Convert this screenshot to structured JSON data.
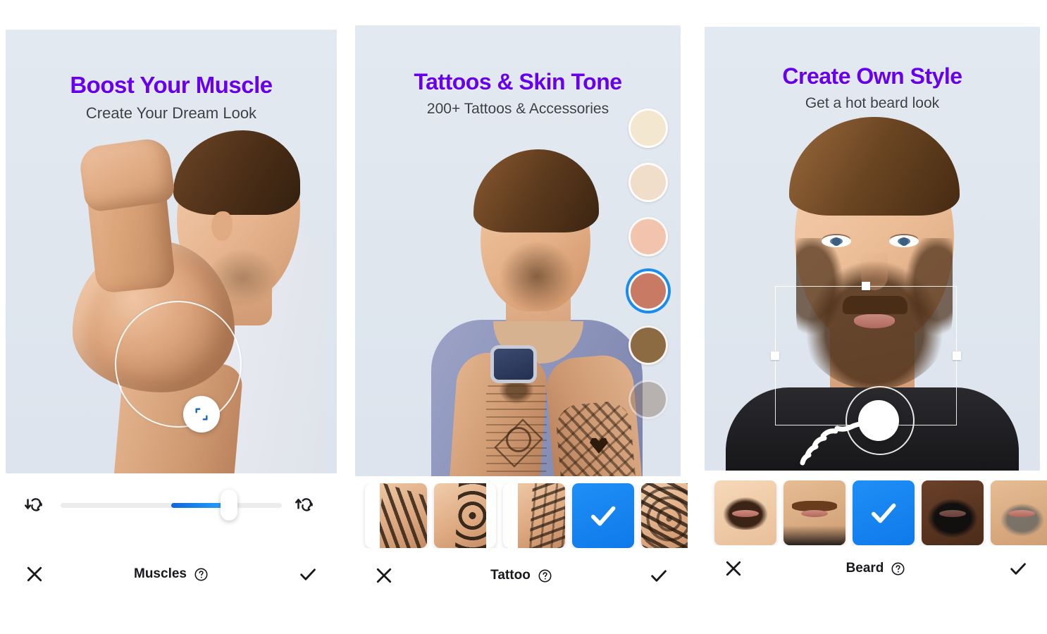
{
  "app": {
    "background_color": "#ffffff",
    "accent_purple": "#6600ee",
    "accent_blue": "#1a8cf0"
  },
  "panels": [
    {
      "id": "muscles",
      "title": "Boost Your Muscle",
      "subtitle": "Create Your Dream Look",
      "editor": {
        "selection_shape": "circle",
        "handle_icon": "resize-handle-icon"
      },
      "slider": {
        "left_icon": "muscle-decrease-icon",
        "right_icon": "muscle-increase-icon",
        "value_percent": 76,
        "fill_start_percent": 50
      },
      "bottombar": {
        "cancel_icon": "close-icon",
        "label": "Muscles",
        "help_icon": "help-circle-icon",
        "confirm_icon": "check-icon"
      }
    },
    {
      "id": "tattoo",
      "title": "Tattoos & Skin Tone",
      "subtitle": "200+ Tattoos & Accessories",
      "skin_tones": [
        {
          "name": "ivory",
          "color": "#f3e7cf",
          "selected": false,
          "faded": false
        },
        {
          "name": "light-beige",
          "color": "#f0ddca",
          "selected": false,
          "faded": false
        },
        {
          "name": "rose-beige",
          "color": "#f2c3ad",
          "selected": false,
          "faded": false
        },
        {
          "name": "terracotta",
          "color": "#c97a64",
          "selected": true,
          "faded": false
        },
        {
          "name": "medium-brown",
          "color": "#8c6a42",
          "selected": false,
          "faded": false
        },
        {
          "name": "deep-brown",
          "color": "#8a7566",
          "selected": false,
          "faded": true
        }
      ],
      "thumbnails": [
        {
          "name": "tattoo-thumb-tribal-chest",
          "selected": false,
          "art": "a"
        },
        {
          "name": "tattoo-thumb-maori-sleeve",
          "selected": false,
          "art": "b"
        },
        {
          "name": "tattoo-thumb-symbols-shoulder",
          "selected": false,
          "art": "c"
        },
        {
          "name": "tattoo-thumb-selected",
          "selected": true,
          "art": "none"
        },
        {
          "name": "tattoo-thumb-ornamental-arm",
          "selected": false,
          "art": "e"
        }
      ],
      "bottombar": {
        "cancel_icon": "close-icon",
        "label": "Tattoo",
        "help_icon": "help-circle-icon",
        "confirm_icon": "check-icon"
      }
    },
    {
      "id": "beard",
      "title": "Create Own Style",
      "subtitle": "Get a hot beard look",
      "editor": {
        "selection_shape": "rectangle",
        "gesture_icon": "tap-hand-icon"
      },
      "thumbnails": [
        {
          "name": "beard-thumb-full-chinstrap",
          "selected": false,
          "art": "b1"
        },
        {
          "name": "beard-thumb-handlebar-moustache",
          "selected": false,
          "art": "b2"
        },
        {
          "name": "beard-thumb-selected",
          "selected": true,
          "art": "none"
        },
        {
          "name": "beard-thumb-dark-full-beard",
          "selected": false,
          "art": "b4"
        },
        {
          "name": "beard-thumb-grey-stubble",
          "selected": false,
          "art": "b5"
        }
      ],
      "bottombar": {
        "cancel_icon": "close-icon",
        "label": "Beard",
        "help_icon": "help-circle-icon",
        "confirm_icon": "check-icon"
      }
    }
  ]
}
